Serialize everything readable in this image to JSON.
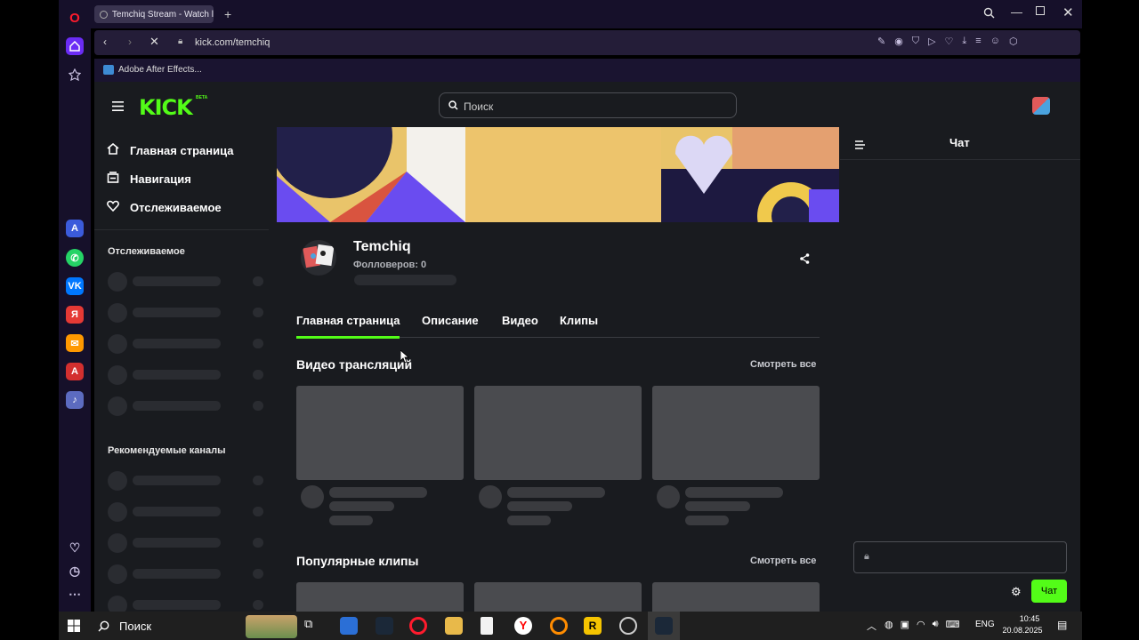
{
  "browser": {
    "tab_title": "Temchiq Stream - Watch l",
    "url": "kick.com/temchiq",
    "bookmark": "Adobe After Effects..."
  },
  "header": {
    "logo_text": "KICK",
    "logo_badge": "BETA",
    "search_placeholder": "Поиск"
  },
  "leftnav": {
    "items": [
      {
        "label": "Главная страница",
        "icon": "home-icon"
      },
      {
        "label": "Навигация",
        "icon": "browse-icon"
      },
      {
        "label": "Отслеживаемое",
        "icon": "heart-icon"
      }
    ],
    "section_following": "Отслеживаемое",
    "section_recommended": "Рекомендуемые каналы"
  },
  "channel": {
    "name": "Temchiq",
    "followers": "Фолловеров: 0"
  },
  "tabs": [
    "Главная страница",
    "Описание",
    "Видео",
    "Клипы"
  ],
  "sections": {
    "videos_title": "Видео трансляций",
    "videos_link": "Смотреть все",
    "clips_title": "Популярные клипы",
    "clips_link": "Смотреть все"
  },
  "chat": {
    "title": "Чат",
    "send_label": "Чат"
  },
  "taskbar": {
    "search_label": "Поиск",
    "lang": "ENG",
    "time": "10:45",
    "date": "20.08.2025"
  },
  "colors": {
    "kick_green": "#53fc18",
    "page_bg": "#191b1f",
    "opera_red": "#ff1b2d"
  }
}
